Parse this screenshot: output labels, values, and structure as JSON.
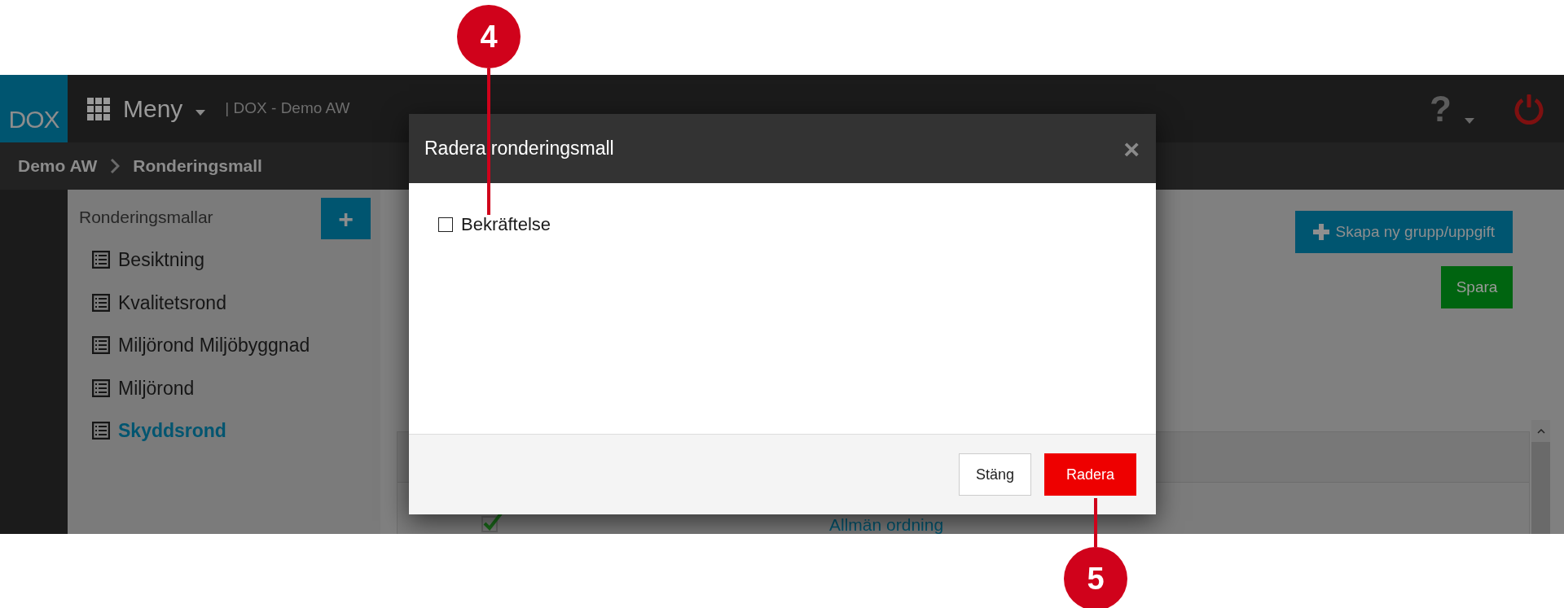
{
  "callouts": [
    {
      "label": "4"
    },
    {
      "label": "5"
    }
  ],
  "navbar": {
    "logo": "DOX",
    "menu": "Meny",
    "subtitle": "| DOX - Demo AW",
    "help": "?"
  },
  "breadcrumb": [
    {
      "label": "Demo AW"
    },
    {
      "label": "Ronderingsmall"
    }
  ],
  "sidebar": {
    "title": "Ronderingsmallar",
    "add_button": "+",
    "items": [
      {
        "label": "Besiktning",
        "selected": false
      },
      {
        "label": "Kvalitetsrond",
        "selected": false
      },
      {
        "label": "Miljörond Miljöbyggnad",
        "selected": false
      },
      {
        "label": "Miljörond",
        "selected": false
      },
      {
        "label": "Skyddsrond",
        "selected": true
      }
    ]
  },
  "main": {
    "create_button": "Skapa ny grupp/uppgift",
    "save_button": "Spara",
    "table": {
      "rows": [
        {
          "checked": true,
          "title": "Allmän ordning"
        }
      ]
    }
  },
  "dialog": {
    "title": "Radera ronderingsmall",
    "close": "×",
    "checkbox": {
      "label": "Bekräftelse",
      "checked": false
    },
    "buttons": [
      {
        "label": "Stäng",
        "kind": "secondary"
      },
      {
        "label": "Radera",
        "kind": "danger"
      }
    ]
  }
}
